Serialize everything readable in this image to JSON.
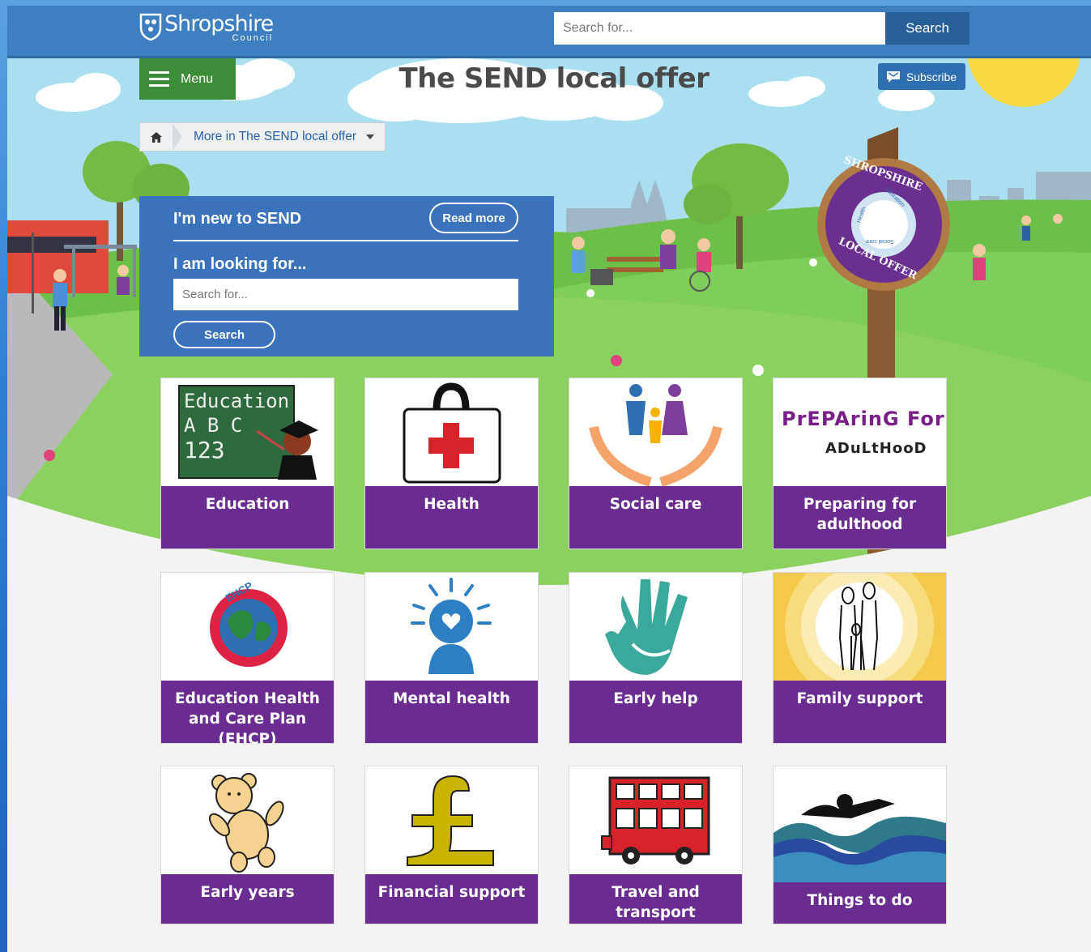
{
  "header": {
    "logo_name": "Shropshire",
    "logo_sub": "Council",
    "search_placeholder": "Search for...",
    "search_button": "Search"
  },
  "hero": {
    "menu_label": "Menu",
    "page_title": "The SEND local offer",
    "subscribe_label": "Subscribe",
    "breadcrumb_link": "More in The SEND local offer",
    "signpost_top": "SHROPSHIRE",
    "signpost_bottom": "LOCAL OFFER",
    "signpost_words": [
      "Health",
      "Education",
      "Social care"
    ]
  },
  "panel": {
    "new_label": "I'm new to SEND",
    "read_more": "Read more",
    "looking_for": "I am looking for...",
    "search_placeholder": "Search for...",
    "search_button": "Search"
  },
  "tiles": [
    {
      "label": "Education",
      "icon": "chalkboard-icon",
      "pic_text": [
        "Education",
        "A B C",
        "123"
      ]
    },
    {
      "label": "Health",
      "icon": "first-aid-kit-icon"
    },
    {
      "label": "Social care",
      "icon": "family-in-hands-icon"
    },
    {
      "label": "Preparing for adulthood",
      "icon": "preparing-for-adulthood-icon",
      "pic_text": [
        "PrEPArinG For",
        "ADuLtHooD"
      ]
    },
    {
      "label": "Education Health and Care Plan (EHCP)",
      "icon": "globe-children-icon",
      "pic_text": [
        "EHCP"
      ]
    },
    {
      "label": "Mental health",
      "icon": "head-heart-icon"
    },
    {
      "label": "Early help",
      "icon": "helping-hands-icon"
    },
    {
      "label": "Family support",
      "icon": "family-icon"
    },
    {
      "label": "Early years",
      "icon": "teddy-bear-icon"
    },
    {
      "label": "Financial support",
      "icon": "pound-sign-icon"
    },
    {
      "label": "Travel and transport",
      "icon": "bus-icon"
    },
    {
      "label": "Things to do",
      "icon": "swimmer-icon"
    }
  ],
  "colors": {
    "header": "#3d7fc0",
    "menu": "#3c8d38",
    "panel": "#3a72bc",
    "tile_caption": "#6b2c91"
  }
}
